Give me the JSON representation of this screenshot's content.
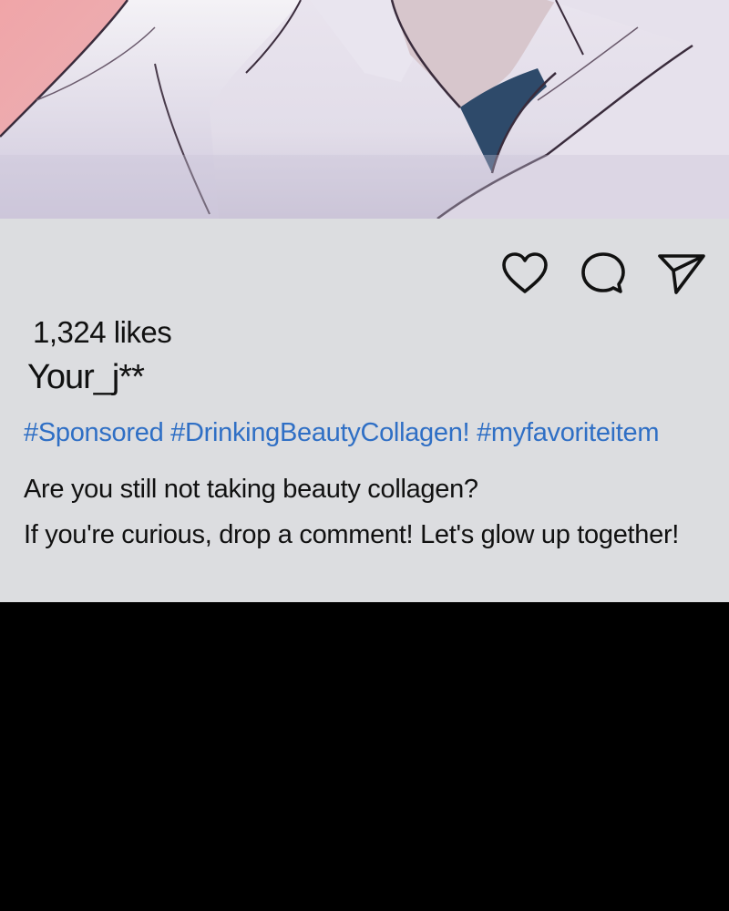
{
  "post": {
    "likes": "1,324 likes",
    "username": "Your_j**",
    "hashtags": [
      "#Sponsored",
      "#DrinkingBeautyCollagen!",
      "#myfavoriteitem"
    ],
    "caption_lines": [
      "Are you still not taking beauty collagen?",
      "If you're curious, drop a comment! Let's glow up together!"
    ],
    "actions": {
      "like_icon": "heart-icon",
      "comment_icon": "comment-bubble-icon",
      "share_icon": "paper-plane-icon"
    }
  },
  "colors": {
    "panel_background": "#dcdde0",
    "hashtag": "#2f6fc5",
    "text": "#111111",
    "bottom_area": "#000000"
  }
}
